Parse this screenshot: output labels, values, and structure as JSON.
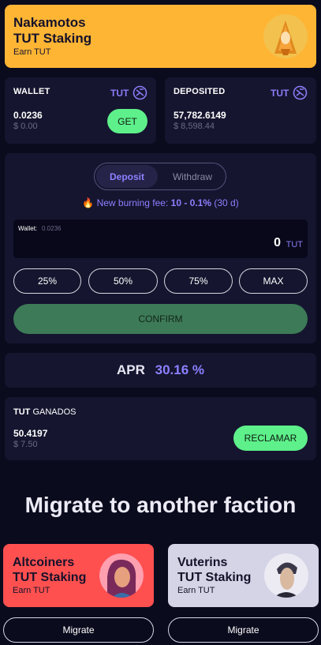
{
  "header": {
    "title_line1": "Nakamotos",
    "title_line2": "TUT Staking",
    "subtitle": "Earn TUT"
  },
  "wallet": {
    "label": "WALLET",
    "token": "TUT",
    "amount": "0.0236",
    "usd": "$ 0.00",
    "get_label": "GET"
  },
  "deposited": {
    "label": "DEPOSITED",
    "token": "TUT",
    "amount": "57,782.6149",
    "usd": "$ 8,598.44"
  },
  "stake_panel": {
    "tabs": [
      "Deposit",
      "Withdraw"
    ],
    "active_tab": "Deposit",
    "fee_prefix": "New burning fee:",
    "fee_value": "10 - 0.1%",
    "fee_suffix": "(30 d)",
    "input_label": "Wallet:",
    "input_balance": "0.0236",
    "input_value": "0",
    "input_unit": "TUT",
    "percent_buttons": [
      "25%",
      "50%",
      "75%",
      "MAX"
    ],
    "confirm_label": "CONFIRM"
  },
  "apr": {
    "label": "APR",
    "value": "30.16 %"
  },
  "earned": {
    "token": "TUT",
    "label": "GANADOS",
    "amount": "50.4197",
    "usd": "$ 7.50",
    "claim_label": "RECLAMAR"
  },
  "migrate": {
    "title": "Migrate to another faction",
    "factions": [
      {
        "line1": "Altcoiners",
        "line2": "TUT Staking",
        "subtitle": "Earn TUT",
        "color": "#ff5050",
        "button": "Migrate"
      },
      {
        "line1": "Vuterins",
        "line2": "TUT Staking",
        "subtitle": "Earn TUT",
        "color": "#d5d4e6",
        "button": "Migrate"
      }
    ]
  },
  "colors": {
    "background": "#0b0b1e",
    "card": "#15152f",
    "accent": "#8b7cf6",
    "header": "#ffb534",
    "green": "#5ef08a"
  }
}
